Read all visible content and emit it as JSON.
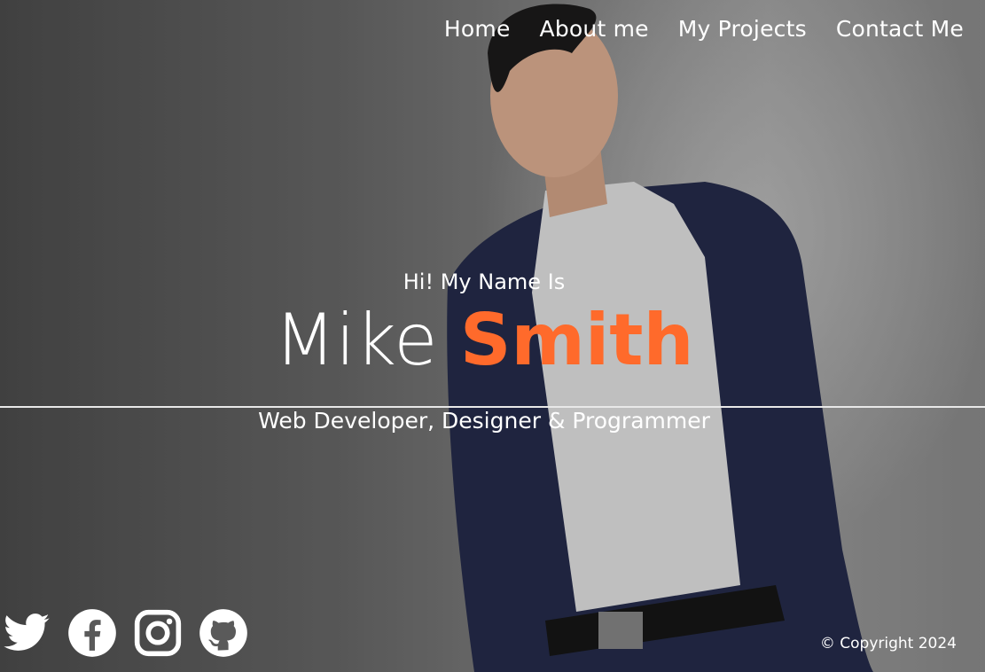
{
  "nav": {
    "items": [
      {
        "label": "Home"
      },
      {
        "label": "About me"
      },
      {
        "label": "My Projects"
      },
      {
        "label": "Contact Me"
      }
    ]
  },
  "hero": {
    "greeting": "Hi! My Name Is",
    "first_name": "Mike",
    "last_name": "Smith",
    "role": "Web Developer, Designer & Programmer",
    "accent_color": "#ff6a2b"
  },
  "social": {
    "icons": [
      "twitter-icon",
      "facebook-icon",
      "instagram-icon",
      "github-icon"
    ]
  },
  "footer": {
    "copyright": "© Copyright 2024"
  }
}
